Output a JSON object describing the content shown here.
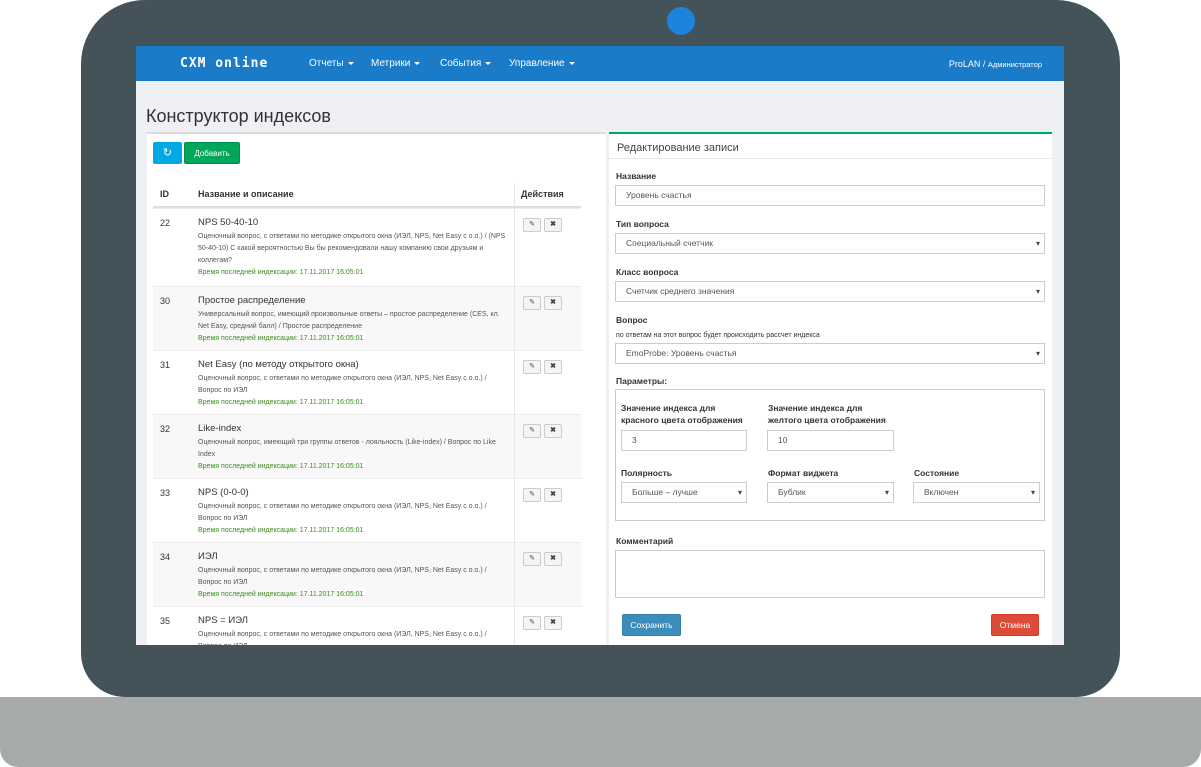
{
  "nav": {
    "logo": "CXM online",
    "items": [
      "Отчеты",
      "Метрики",
      "События",
      "Управление"
    ],
    "user": "ProLAN",
    "user_sep": " / ",
    "role": "Администратор"
  },
  "page_title": "Конструктор индексов",
  "toolbar": {
    "refresh_icon": "↻",
    "add_label": "Добавить"
  },
  "table": {
    "headers": {
      "id": "ID",
      "name": "Название и описание",
      "actions": "Действия"
    },
    "rows": [
      {
        "id": "22",
        "title": "NPS 50-40-10",
        "desc": "Оценочный вопрос, с ответами по методике открытого окна (ИЭЛ, NPS, Net Easy с о.о.) / (NPS 50-40-10) С какой вероятностью Вы бы рекомендовали нашу компанию свои друзьям и коллегам?",
        "time": "Время последней индексации: 17.11.2017 16:05:01"
      },
      {
        "id": "30",
        "title": "Простое распределение",
        "desc": "Универсальный вопрос, имеющий произвольные ответы – простое распределение (CES, кл. Net Easy, средний балл) / Простое распределение",
        "time": "Время последней индексации: 17.11.2017 16:05:01"
      },
      {
        "id": "31",
        "title": "Net Easy (по методу открытого окна)",
        "desc": "Оценочный вопрос, с ответами по методике открытого окна (ИЭЛ, NPS, Net Easy с о.о.) / Вопрос по ИЭЛ",
        "time": "Время последней индексации: 17.11.2017 16:05:01"
      },
      {
        "id": "32",
        "title": "Like-index",
        "desc": "Оценочный вопрос, имеющий три группы ответов - лояльность (Like-index) / Вопрос по Like Index",
        "time": "Время последней индексации: 17.11.2017 16:05:01"
      },
      {
        "id": "33",
        "title": "NPS (0-0-0)",
        "desc": "Оценочный вопрос, с ответами по методике открытого окна (ИЭЛ, NPS, Net Easy с о.о.) / Вопрос по ИЭЛ",
        "time": "Время последней индексации: 17.11.2017 16:05:01"
      },
      {
        "id": "34",
        "title": "ИЭЛ",
        "desc": "Оценочный вопрос, с ответами по методике открытого окна (ИЭЛ, NPS, Net Easy с о.о.) / Вопрос по ИЭЛ",
        "time": "Время последней индексации: 17.11.2017 16:05:01"
      },
      {
        "id": "35",
        "title": "NPS = ИЭЛ",
        "desc": "Оценочный вопрос, с ответами по методике открытого окна (ИЭЛ, NPS, Net Easy с о.о.) / Вопрос по ИЭЛ",
        "time": ""
      }
    ],
    "edit_icon": "✎",
    "delete_icon": "✖"
  },
  "form": {
    "title": "Редактирование записи",
    "name_label": "Название",
    "name_value": "Уровень счастья",
    "qtype_label": "Тип вопроса",
    "qtype_value": "Специальный счетчик",
    "qclass_label": "Класс вопроса",
    "qclass_value": "Счетчик среднего значения",
    "question_label": "Вопрос",
    "question_hint": "по ответам на этот вопрос будет происходить рассчет индекса",
    "question_value": "EmoProbe: Уровень счастья",
    "params_label": "Параметры:",
    "red_label": "Значение индекса для красного цвета отображения",
    "red_value": "3",
    "yellow_label": "Значение индекса для желтого цвета отображения",
    "yellow_value": "10",
    "polarity_label": "Полярность",
    "polarity_value": "Больше – лучше",
    "widget_label": "Формат виджета",
    "widget_value": "Бублик",
    "state_label": "Состояние",
    "state_value": "Включен",
    "comment_label": "Комментарий",
    "comment_value": "",
    "save_label": "Сохранить",
    "cancel_label": "Отмена"
  },
  "colors": {
    "navbar": "#1a7bc9",
    "shell": "#44525a",
    "camera": "#1c84dd",
    "add": "#00a65a",
    "refresh": "#00a9e3",
    "save": "#3c8dbc",
    "cancel": "#dd4b39",
    "timestamp": "#3c8d1c"
  }
}
